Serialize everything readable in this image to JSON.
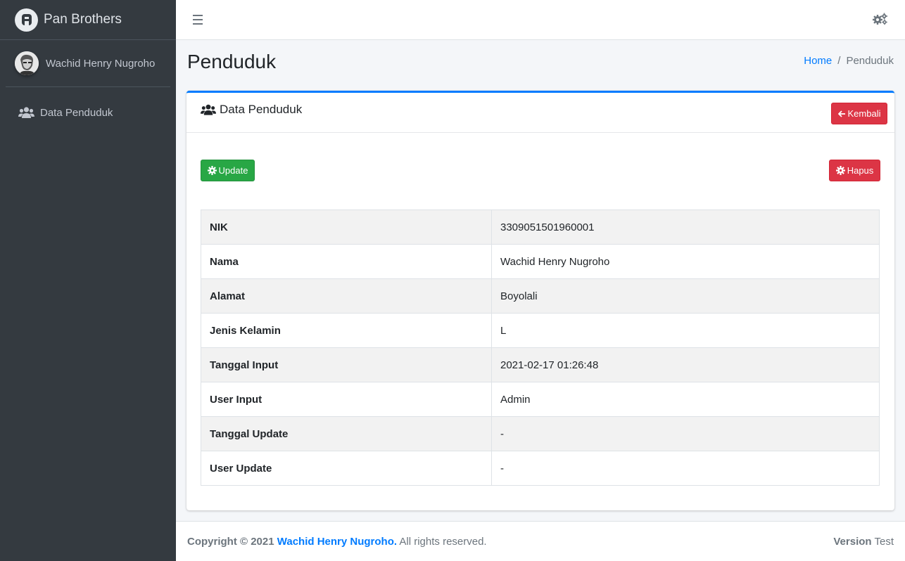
{
  "sidebar": {
    "brand": "Pan Brothers",
    "user_name": "Wachid Henry Nugroho",
    "items": [
      {
        "label": "Data Penduduk",
        "icon": "users-icon"
      }
    ]
  },
  "header": {
    "menu_icon": "bars-icon",
    "settings_icon": "cogs-icon"
  },
  "content": {
    "title": "Penduduk",
    "breadcrumb": {
      "home": "Home",
      "separator": "/",
      "current": "Penduduk"
    }
  },
  "card": {
    "title": "Data Penduduk",
    "back_label": "Kembali",
    "update_label": "Update",
    "delete_label": "Hapus",
    "rows": [
      {
        "key": "NIK",
        "value": "3309051501960001"
      },
      {
        "key": "Nama",
        "value": "Wachid Henry Nugroho"
      },
      {
        "key": "Alamat",
        "value": "Boyolali"
      },
      {
        "key": "Jenis Kelamin",
        "value": "L"
      },
      {
        "key": "Tanggal Input",
        "value": "2021-02-17 01:26:48"
      },
      {
        "key": "User Input",
        "value": "Admin"
      },
      {
        "key": "Tanggal Update",
        "value": "-"
      },
      {
        "key": "User Update",
        "value": "-"
      }
    ]
  },
  "footer": {
    "copyright_prefix": "Copyright © 2021",
    "author": "Wachid Henry Nugroho.",
    "rights": "All rights reserved.",
    "version_label": "Version",
    "version_value": "Test"
  },
  "colors": {
    "sidebar_bg": "#343a40",
    "primary": "#007bff",
    "success": "#28a745",
    "danger": "#dc3545"
  }
}
